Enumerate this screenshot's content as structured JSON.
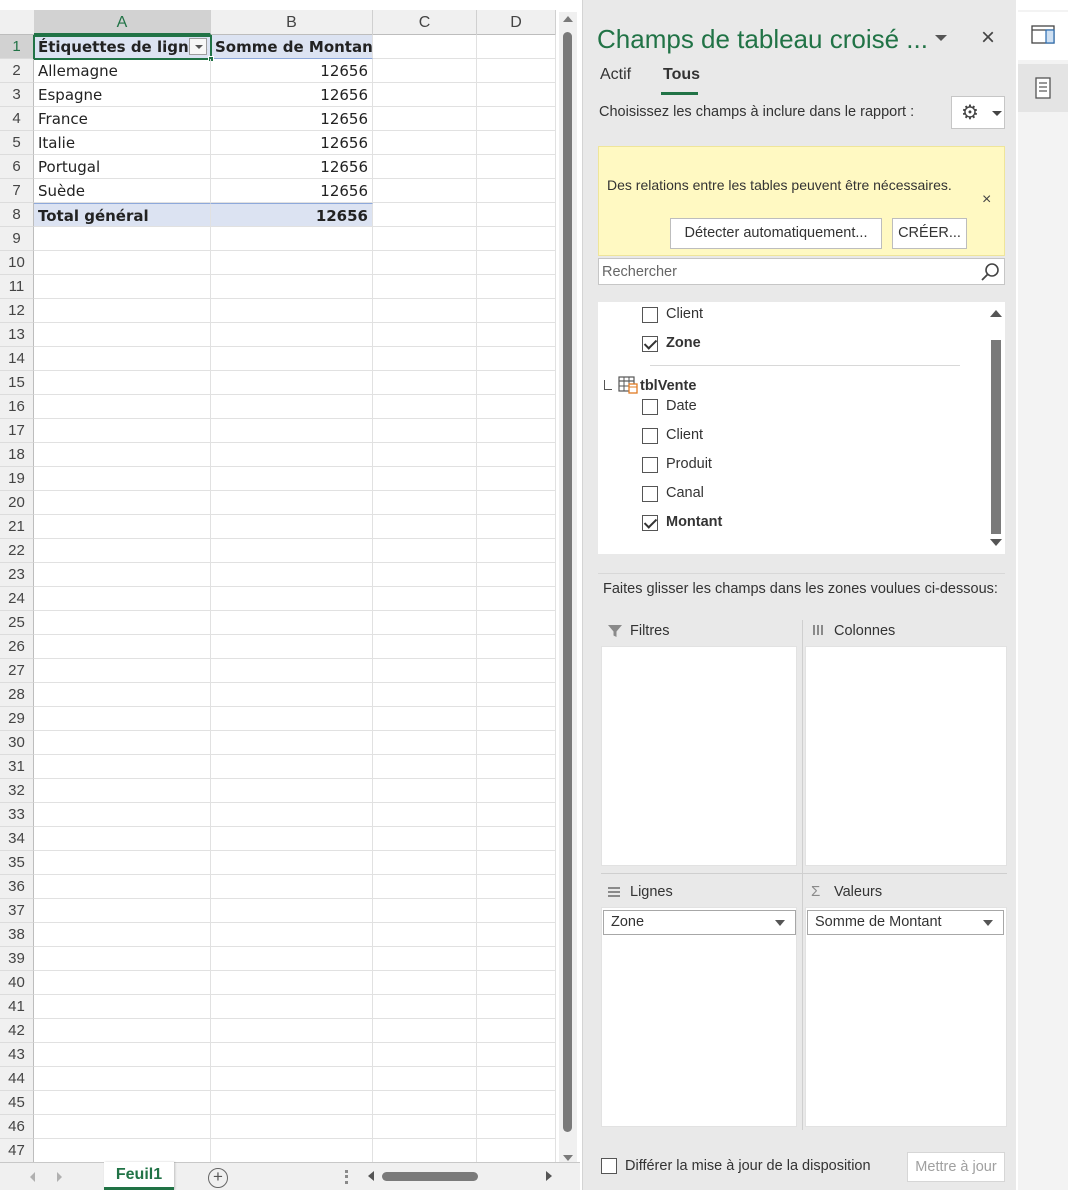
{
  "sheet": {
    "columns": [
      "A",
      "B",
      "C",
      "D"
    ],
    "pivot_header": {
      "a": "Étiquettes de lignes",
      "b": "Somme de Montant"
    },
    "pivot_rows": [
      {
        "label": "Allemagne",
        "value": "12656"
      },
      {
        "label": "Espagne",
        "value": "12656"
      },
      {
        "label": "France",
        "value": "12656"
      },
      {
        "label": "Italie",
        "value": "12656"
      },
      {
        "label": "Portugal",
        "value": "12656"
      },
      {
        "label": "Suède",
        "value": "12656"
      }
    ],
    "total": {
      "label": "Total général",
      "value": "12656"
    },
    "row_count": 47,
    "active_cell": "A1",
    "tab_name": "Feuil1",
    "add_sheet_symbol": "+"
  },
  "pane": {
    "title": "Champs de tableau croisé ...",
    "close_symbol": "×",
    "tabs": {
      "actif": "Actif",
      "tous": "Tous"
    },
    "active_tab": "Tous",
    "choose_label": "Choisissez les champs à inclure dans le rapport :",
    "gear_symbol": "⚙",
    "notice": {
      "text": "Des relations entre les tables peuvent être nécessaires.",
      "close_symbol": "×",
      "detect_label": "Détecter automatiquement...",
      "create_label": "CRÉER..."
    },
    "search_placeholder": "Rechercher",
    "fields_top": [
      {
        "label": "Client",
        "checked": false
      },
      {
        "label": "Zone",
        "checked": true
      }
    ],
    "table_name": "tblVente",
    "table_fields": [
      {
        "label": "Date",
        "checked": false
      },
      {
        "label": "Client",
        "checked": false
      },
      {
        "label": "Produit",
        "checked": false
      },
      {
        "label": "Canal",
        "checked": false
      },
      {
        "label": "Montant",
        "checked": true
      }
    ],
    "drag_label": "Faites glisser les champs dans les zones voulues ci-dessous:",
    "areas": {
      "filtres": "Filtres",
      "colonnes": "Colonnes",
      "lignes": "Lignes",
      "valeurs": "Valeurs",
      "sigma_symbol": "Σ"
    },
    "lignes_chip": "Zone",
    "valeurs_chip": "Somme de Montant",
    "defer_label": "Différer la mise à jour de la disposition",
    "update_label": "Mettre à jour",
    "colors": {
      "accent": "#217346",
      "pivot_fill": "#dce3f2",
      "notice_bg": "#fff9c2"
    }
  }
}
